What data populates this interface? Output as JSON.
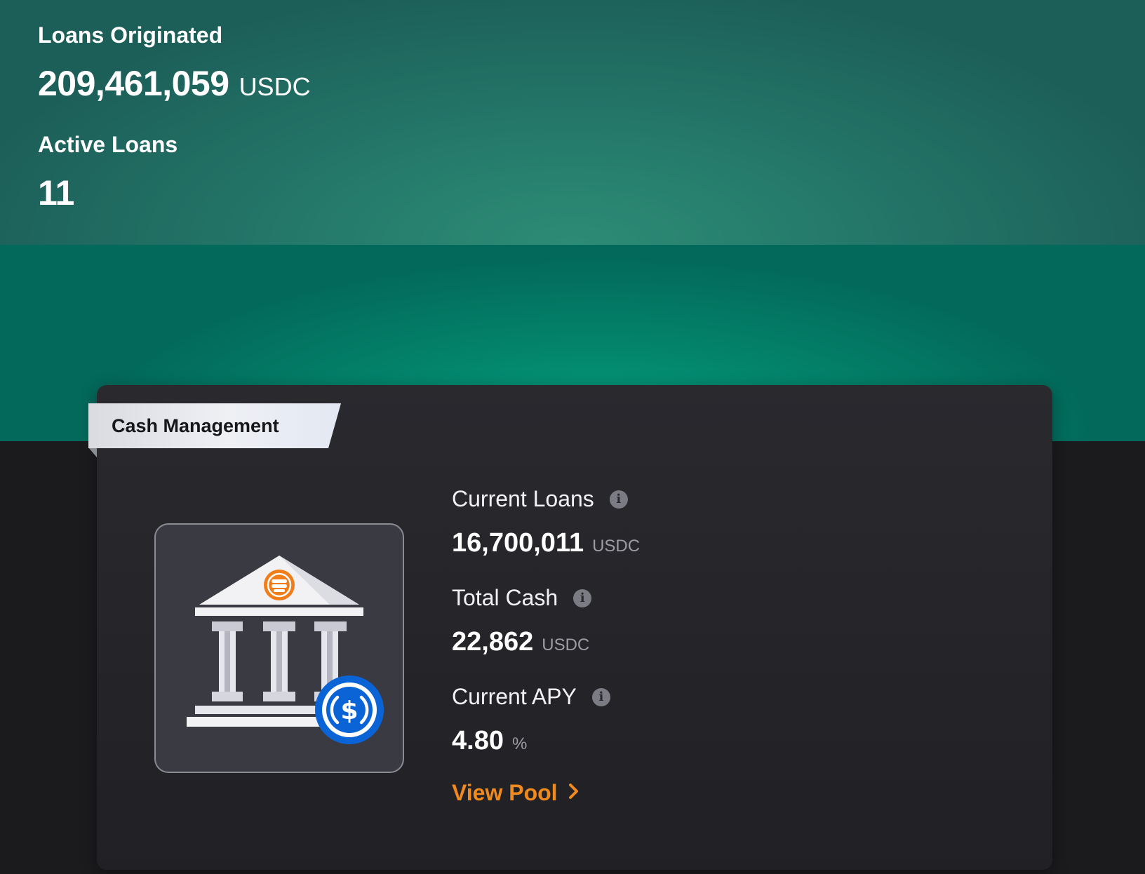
{
  "stats": {
    "loans_originated": {
      "label": "Loans Originated",
      "value": "209,461,059",
      "unit": "USDC"
    },
    "active_loans": {
      "label": "Active Loans",
      "value": "11"
    }
  },
  "pool_card": {
    "tag": "Cash Management",
    "illustration": {
      "name": "bank-building-with-usdc-coin",
      "accent": "#f07d1a",
      "coin_color": "#0b64d6"
    },
    "metrics": [
      {
        "label": "Current Loans",
        "value": "16,700,011",
        "unit": "USDC",
        "icon": "info-icon"
      },
      {
        "label": "Total Cash",
        "value": "22,862",
        "unit": "USDC",
        "icon": "info-icon"
      },
      {
        "label": "Current APY",
        "value": "4.80",
        "unit": "%",
        "icon": "info-icon"
      }
    ],
    "link": {
      "label": "View Pool",
      "icon": "chevron-right-icon",
      "color": "#f08a1c"
    }
  }
}
